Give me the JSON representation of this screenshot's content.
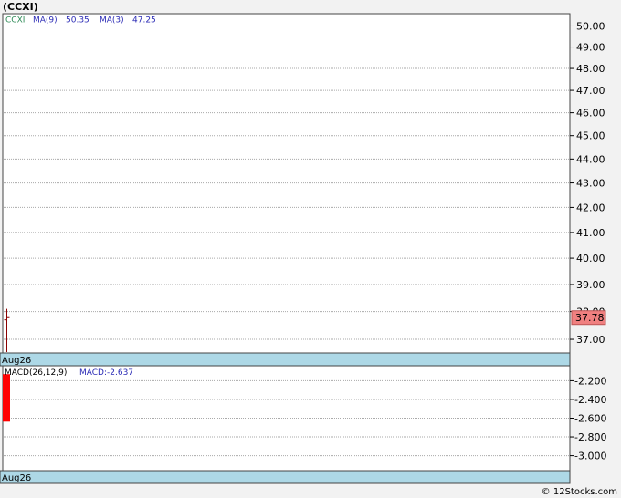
{
  "colors": {
    "background": "#f2f2f2",
    "panel": "#ffffff",
    "frame": "#444444",
    "grid": "#aaaaaa",
    "date_band": "#add8e6",
    "candle": "#8b0000",
    "macd_bar": "#ff0000",
    "price_tag_fill": "#f08080",
    "symbol_label": "#2e8b57",
    "ma_label": "#2a2ab5"
  },
  "chart_data": [
    {
      "type": "line",
      "title": "(CCXI)",
      "legend": {
        "symbol": "CCXI",
        "ma9_label": "MA(9)",
        "ma9_value": "50.35",
        "ma3_label": "MA(3)",
        "ma3_value": "47.25"
      },
      "x": [
        "Aug26"
      ],
      "ohlc": {
        "open": 37.7,
        "high": 38.1,
        "low": 36.5,
        "close": 37.78
      },
      "last_price_label": "37.78",
      "y_ticks": [
        "50.00",
        "49.00",
        "48.00",
        "47.00",
        "46.00",
        "45.00",
        "44.00",
        "43.00",
        "42.00",
        "41.00",
        "40.00",
        "39.00",
        "38.00",
        "37.00"
      ],
      "y_scale": "log",
      "ylim": [
        36.55,
        50.55
      ],
      "grid": true,
      "date_label": "Aug26"
    },
    {
      "type": "bar",
      "legend": {
        "label": "MACD(26,12,9)",
        "value_label": "MACD:-2.637"
      },
      "x": [
        "Aug26"
      ],
      "values": [
        -2.637
      ],
      "y_ticks": [
        "-2.200",
        "-2.400",
        "-2.600",
        "-2.800",
        "-3.000"
      ],
      "ylim": [
        -3.15,
        -2.05
      ],
      "bar_top": -2.13,
      "grid": true,
      "date_label": "Aug26"
    }
  ],
  "footer": {
    "copyright": "© 12Stocks.com"
  }
}
